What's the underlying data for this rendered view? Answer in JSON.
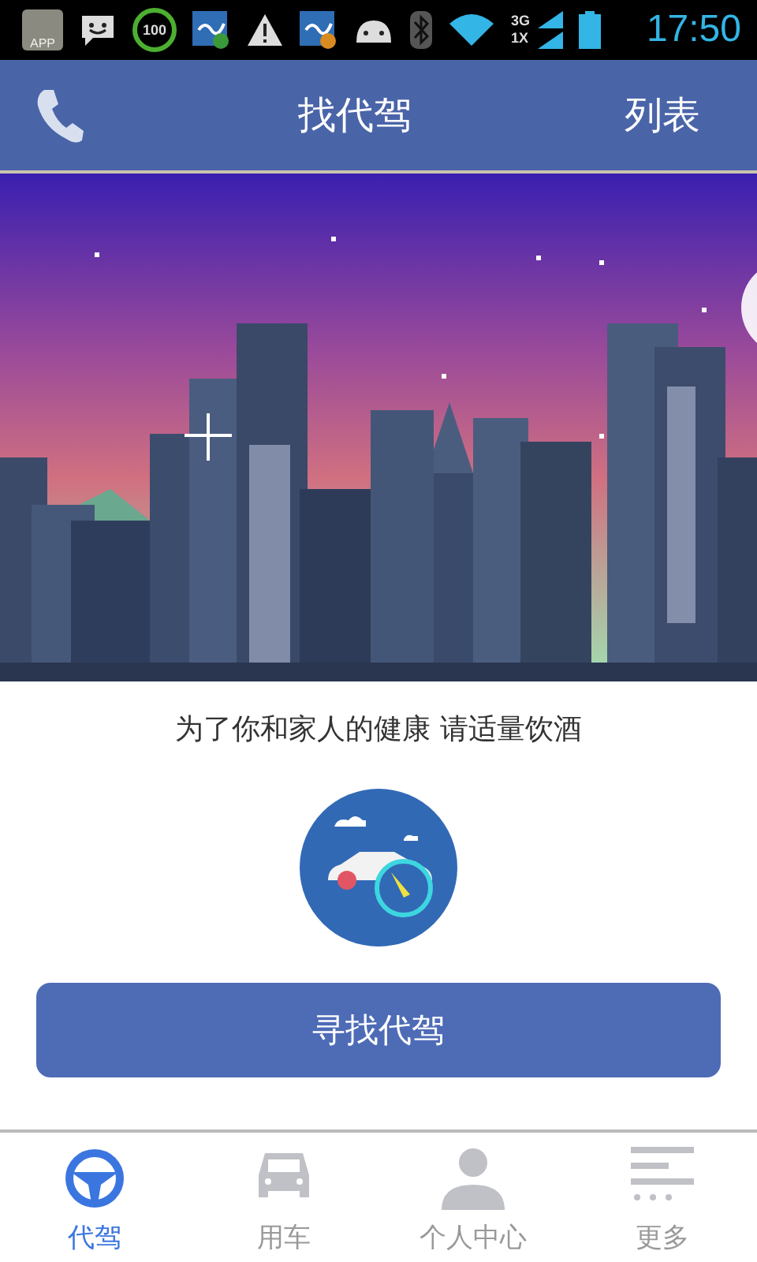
{
  "status_bar": {
    "app_badge": "APP",
    "battery_saver": "100",
    "network_top": "3G",
    "network_bottom": "1X",
    "time": "17:50"
  },
  "header": {
    "title": "找代驾",
    "action": "列表"
  },
  "notice": "为了你和家人的健康 请适量饮酒",
  "primary_button": "寻找代驾",
  "tabs": [
    {
      "kind": "wheel",
      "label": "代驾",
      "selected": true
    },
    {
      "kind": "car",
      "label": "用车",
      "selected": false
    },
    {
      "kind": "person",
      "label": "个人中心",
      "selected": false
    },
    {
      "kind": "more",
      "label": "更多",
      "selected": false
    }
  ]
}
